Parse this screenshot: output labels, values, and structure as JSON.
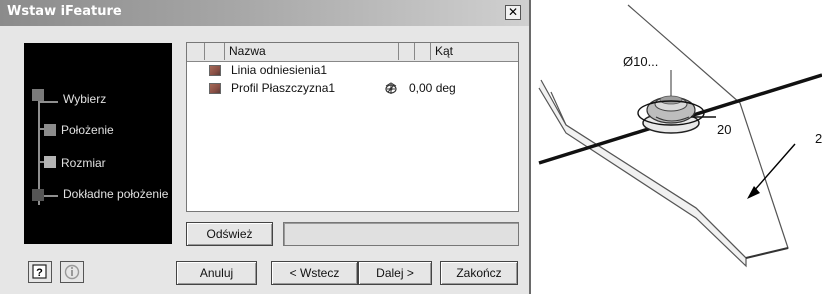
{
  "dialog": {
    "title": "Wstaw iFeature",
    "close_glyph": "✕",
    "steps": [
      {
        "label": "Wybierz",
        "color": "#7a7a7a"
      },
      {
        "label": "Położenie",
        "color": "#8c8c8c"
      },
      {
        "label": "Rozmiar",
        "color": "#b4b4b4"
      },
      {
        "label": "Dokładne położenie",
        "color": "#555555"
      }
    ],
    "table": {
      "columns": [
        "Nazwa",
        "Kąt"
      ],
      "rows": [
        {
          "name": "Linia odniesienia1",
          "kat": ""
        },
        {
          "name": "Profil Płaszczyzna1",
          "kat": "0,00 deg"
        }
      ]
    },
    "buttons": {
      "refresh": "Odśwież",
      "cancel": "Anuluj",
      "back": "< Wstecz",
      "next": "Dalej >",
      "finish": "Zakończ"
    },
    "icons": {
      "help": "question-icon",
      "info": "info-icon"
    }
  },
  "view": {
    "diameter_label": "Ø10...",
    "dimension_label": "20",
    "edge_number": "2"
  }
}
